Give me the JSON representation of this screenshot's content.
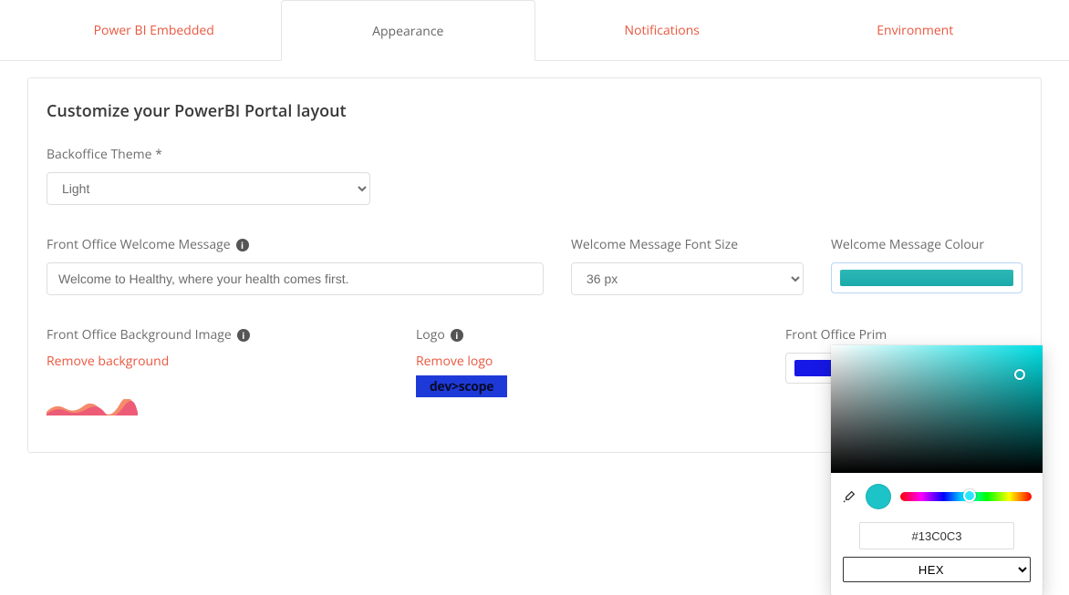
{
  "tabs": {
    "powerbi": "Power BI Embedded",
    "appearance": "Appearance",
    "notifications": "Notifications",
    "environment": "Environment"
  },
  "page": {
    "title": "Customize your PowerBI Portal layout"
  },
  "theme": {
    "label": "Backoffice Theme *",
    "value": "Light"
  },
  "welcome": {
    "label": "Front Office Welcome Message",
    "value": "Welcome to Healthy, where your health comes first."
  },
  "fontsize": {
    "label": "Welcome Message Font Size",
    "value": "36 px"
  },
  "msgcolor": {
    "label": "Welcome Message Colour",
    "hex": "#13C0C3"
  },
  "bgimage": {
    "label": "Front Office Background Image",
    "remove": "Remove background"
  },
  "logo": {
    "label": "Logo",
    "remove": "Remove logo",
    "text": "dev>scope"
  },
  "primary": {
    "label": "Front Office Prim",
    "hex": "#1618E6"
  },
  "picker": {
    "hex": "#13C0C3",
    "format": "HEX"
  }
}
